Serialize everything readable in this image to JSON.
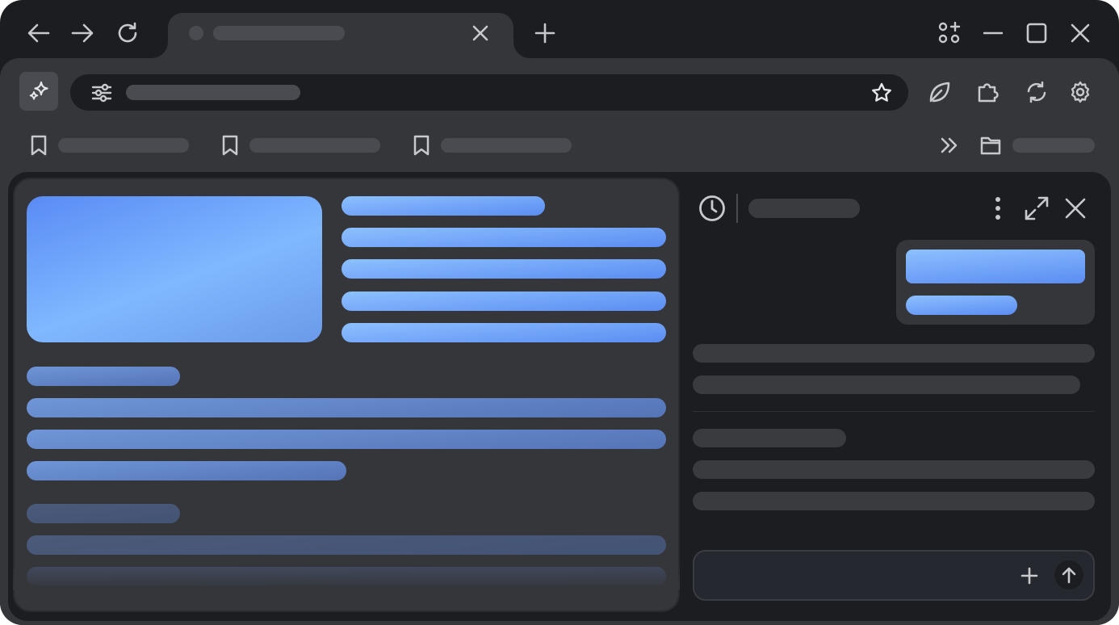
{
  "window": {
    "tab": {
      "title": "",
      "favicon": "tab-favicon-dot"
    },
    "controls": [
      "back-icon",
      "forward-icon",
      "reload-icon",
      "new-tab-icon",
      "apps-icon",
      "minimize-icon",
      "maximize-icon",
      "close-icon"
    ]
  },
  "toolbar": {
    "ai_button_icon": "sparkle-icon",
    "omnibox": {
      "value": "",
      "left_icon": "tune-icon",
      "right_icon": "star-icon"
    },
    "actions": [
      "leaf-icon",
      "extensions-icon",
      "sync-icon",
      "settings-icon"
    ]
  },
  "bookmarks": {
    "items": [
      {
        "label": ""
      },
      {
        "label": ""
      },
      {
        "label": ""
      }
    ],
    "overflow_icon": "chevrons-right-icon",
    "folder": {
      "label": ""
    }
  },
  "side_panel": {
    "header_icon": "history-icon",
    "title": "",
    "menu_icon": "more-vert-icon",
    "expand_icon": "expand-icon",
    "close_icon": "close-icon",
    "prompt": {
      "placeholder": "",
      "add_icon": "plus-icon",
      "send_icon": "arrow-up-icon"
    }
  },
  "colors": {
    "window_bg": "#1c1d20",
    "surface": "#35363a",
    "accent_blue": "#5b8cf2",
    "accent_light_blue": "#8cc1ff",
    "icon": "#c8c9cc"
  }
}
